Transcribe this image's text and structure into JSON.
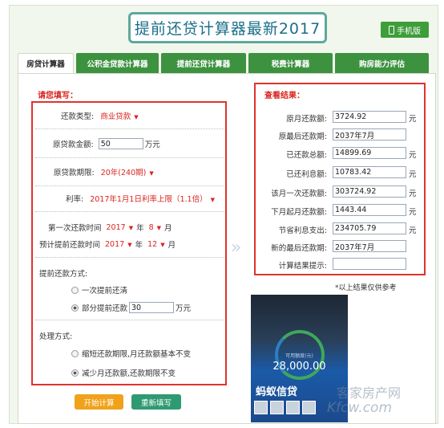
{
  "header": {
    "title": "提前还贷计算器最新2017",
    "mobile_label": "手机版"
  },
  "tabs": [
    {
      "label": "房贷计算器",
      "active": true
    },
    {
      "label": "公积金贷款计算器",
      "active": false
    },
    {
      "label": "提前还贷计算器",
      "active": false
    },
    {
      "label": "税费计算器",
      "active": false
    },
    {
      "label": "购房能力评估",
      "active": false
    }
  ],
  "left": {
    "section_title": "请您填写：",
    "repay_type_label": "还款类型:",
    "repay_type_value": "商业贷款",
    "original_amount_label": "原贷款金额:",
    "original_amount_value": "50",
    "original_amount_unit": "万元",
    "original_term_label": "原贷款期限:",
    "original_term_value": "20年(240期)",
    "rate_label": "利率:",
    "rate_value": "2017年1月1日利率上限（1.1倍）",
    "first_repay_label": "第一次还款时间",
    "first_repay_year": "2017",
    "first_repay_month": "8",
    "planned_repay_label": "预计提前还款时间",
    "planned_repay_year": "2017",
    "planned_repay_month": "12",
    "year_word": "年",
    "month_word": "月",
    "prepay_method_label": "提前还款方式:",
    "prepay_option_all": "一次提前还清",
    "prepay_option_part": "部分提前还款",
    "prepay_part_value": "30",
    "prepay_part_unit": "万元",
    "handle_label": "处理方式:",
    "handle_option_1": "缩短还款期限,月还款额基本不变",
    "handle_option_2": "减少月还款额,还款期限不变",
    "btn_calc": "开始计算",
    "btn_reset": "重新填写"
  },
  "right": {
    "section_title": "查看结果：",
    "rows": [
      {
        "label": "原月还款额:",
        "value": "3724.92",
        "unit": "元"
      },
      {
        "label": "原最后还款期:",
        "value": "2037年7月",
        "unit": ""
      },
      {
        "label": "已还款总额:",
        "value": "14899.69",
        "unit": "元"
      },
      {
        "label": "已还利息额:",
        "value": "10783.42",
        "unit": "元"
      },
      {
        "label": "该月一次还款额:",
        "value": "303724.92",
        "unit": "元"
      },
      {
        "label": "下月起月还款额:",
        "value": "1443.44",
        "unit": "元"
      },
      {
        "label": "节省利息支出:",
        "value": "234705.79",
        "unit": "元"
      },
      {
        "label": "新的最后还款期:",
        "value": "2037年7月",
        "unit": ""
      },
      {
        "label": "计算结果提示:",
        "value": "",
        "unit": ""
      }
    ],
    "note": "*以上结果仅供参考"
  },
  "ad": {
    "small_label": "可用额度(元)",
    "amount": "28,000.00",
    "brand": "蚂蚁信贷"
  },
  "watermark": {
    "line1": "客家房产网",
    "line2": "Kfcw.com"
  }
}
